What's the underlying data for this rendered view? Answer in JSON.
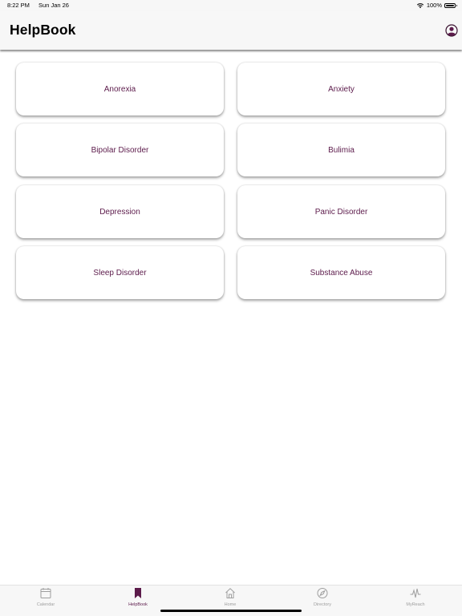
{
  "status_bar": {
    "time": "8:22 PM",
    "date": "Sun Jan 26",
    "battery": "100%",
    "battery_level": 1.0
  },
  "navbar": {
    "title": "HelpBook",
    "profile_icon": "person-circle-icon"
  },
  "topics": [
    {
      "label": "Anorexia"
    },
    {
      "label": "Anxiety"
    },
    {
      "label": "Bipolar Disorder"
    },
    {
      "label": "Bulimia"
    },
    {
      "label": "Depression"
    },
    {
      "label": "Panic Disorder"
    },
    {
      "label": "Sleep Disorder"
    },
    {
      "label": "Substance Abuse"
    }
  ],
  "tab_bar": {
    "tabs": [
      {
        "label": "Calendar",
        "icon": "calendar-icon",
        "active": false
      },
      {
        "label": "HelpBook",
        "icon": "bookmark-icon",
        "active": true
      },
      {
        "label": "Home",
        "icon": "house-icon",
        "active": false
      },
      {
        "label": "Directory",
        "icon": "compass-icon",
        "active": false
      },
      {
        "label": "MyReach",
        "icon": "heartbeat-icon",
        "active": false
      }
    ]
  },
  "colors": {
    "accent": "#5c1b4b",
    "inactive": "#9e9e9e",
    "bar_background": "#f7f7f7"
  }
}
